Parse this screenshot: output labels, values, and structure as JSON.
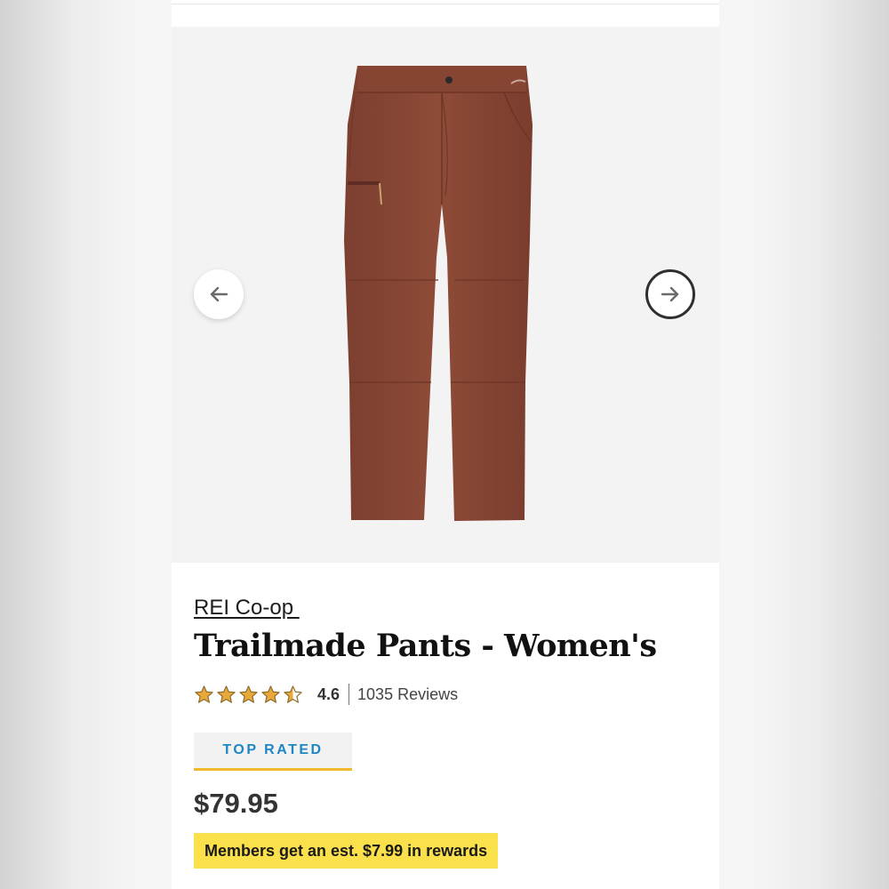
{
  "product": {
    "brand": "REI Co-op ",
    "title": "Trailmade Pants - Women's",
    "rating": {
      "value": 4.6,
      "value_label": "4.6",
      "stars_filled": 4.5,
      "stars_total": 5
    },
    "reviews_label": "1035 Reviews",
    "badge": "TOP RATED",
    "price": "$79.95",
    "rewards": "Members get an est. $7.99 in rewards"
  },
  "gallery": {
    "prev_icon": "arrow-left-icon",
    "next_icon": "arrow-right-icon"
  },
  "colors": {
    "pant": "#8a4836",
    "star": "#e8a93a",
    "badge_text": "#1d86c5",
    "badge_underline": "#f3b92e",
    "rewards_bg": "#fae04a"
  }
}
